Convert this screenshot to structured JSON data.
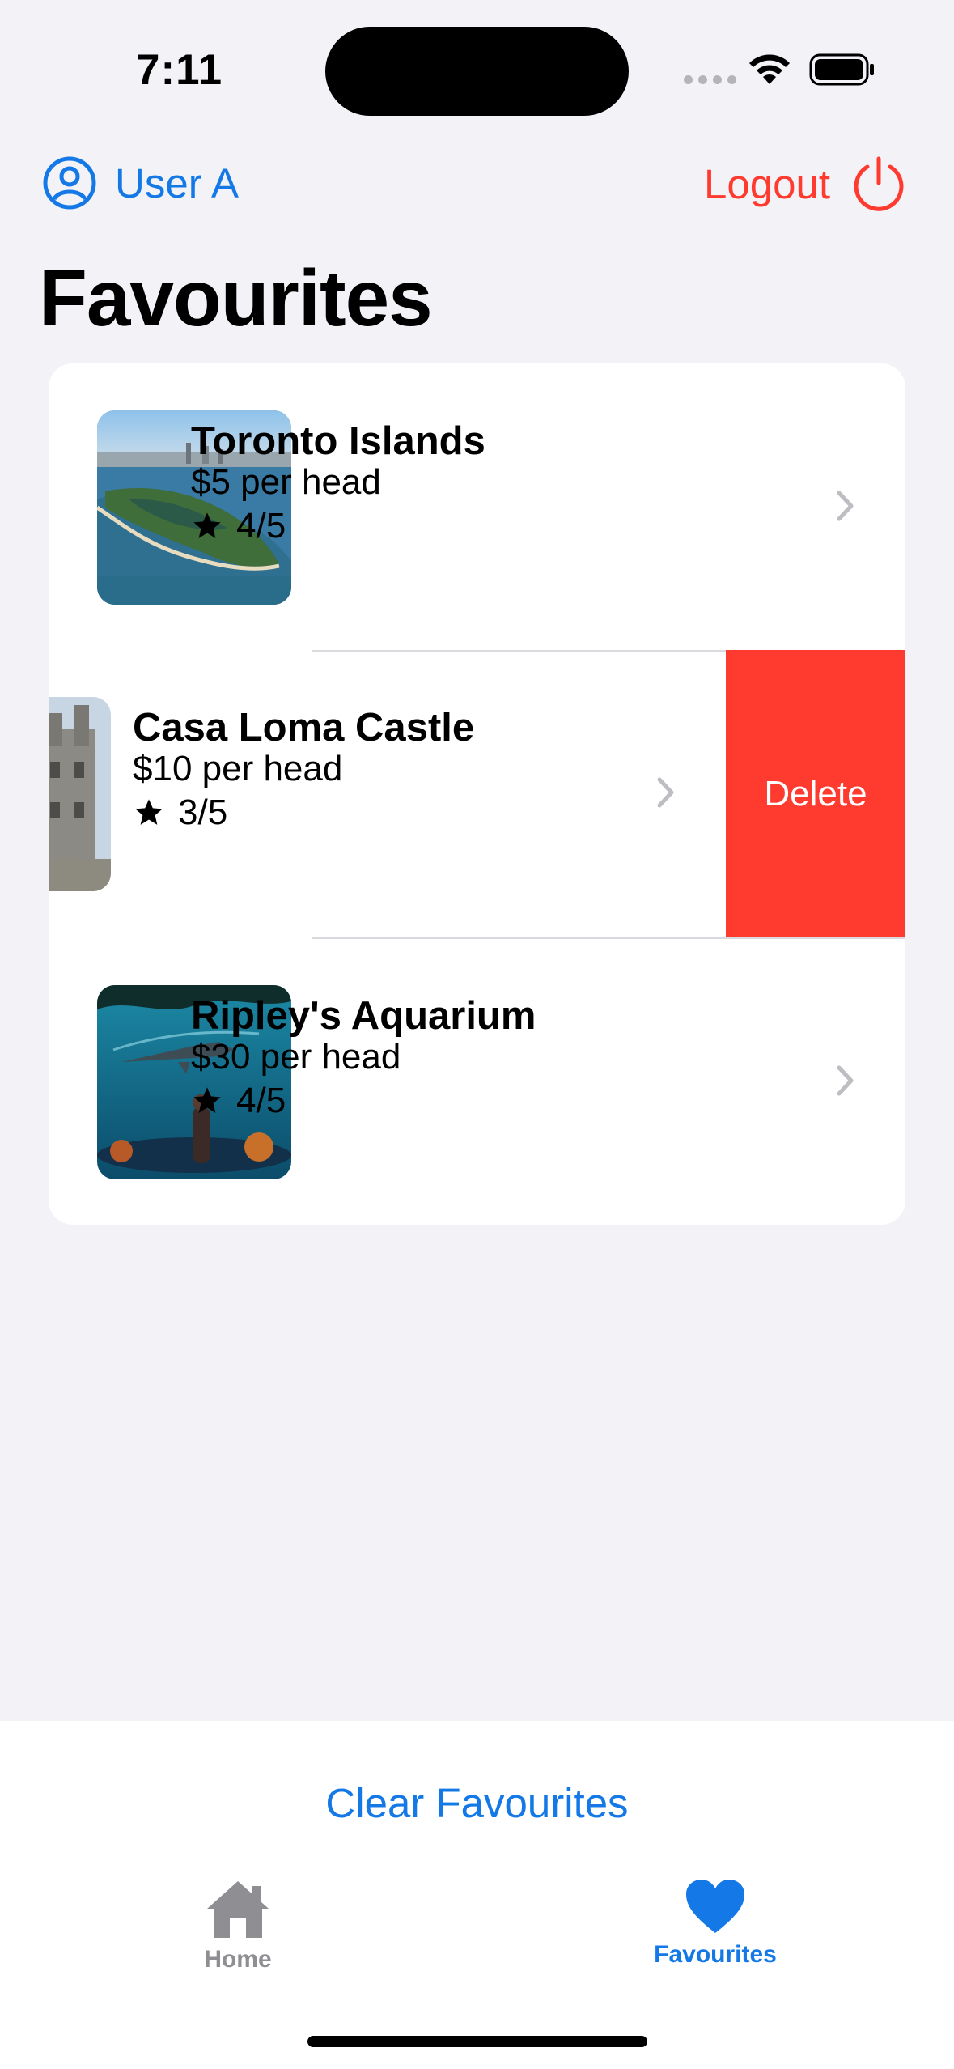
{
  "status_bar": {
    "time": "7:11"
  },
  "header": {
    "user_label": "User A",
    "logout_label": "Logout",
    "title": "Favourites"
  },
  "favourites": [
    {
      "title": "Toronto Islands",
      "price": "$5 per head",
      "rating": "4/5",
      "image": "toronto-islands-aerial-photo"
    },
    {
      "title": "Casa Loma Castle",
      "price": "$10 per head",
      "rating": "3/5",
      "image": "casa-loma-castle-photo"
    },
    {
      "title": "Ripley's Aquarium",
      "price": "$30 per head",
      "rating": "4/5",
      "image": "ripleys-aquarium-tunnel-photo"
    }
  ],
  "swipe_action": {
    "label": "Delete",
    "color": "#ff3b30"
  },
  "footer": {
    "clear_label": "Clear Favourites"
  },
  "tab_bar": {
    "tabs": [
      {
        "label": "Home",
        "icon": "house-icon",
        "selected": false
      },
      {
        "label": "Favourites",
        "icon": "heart-icon",
        "selected": true
      }
    ],
    "active_color": "#1478e6",
    "inactive_color": "#8e8e93"
  },
  "colors": {
    "accent": "#1478e6",
    "destructive": "#ff3b30",
    "background": "#f2f2f7"
  }
}
